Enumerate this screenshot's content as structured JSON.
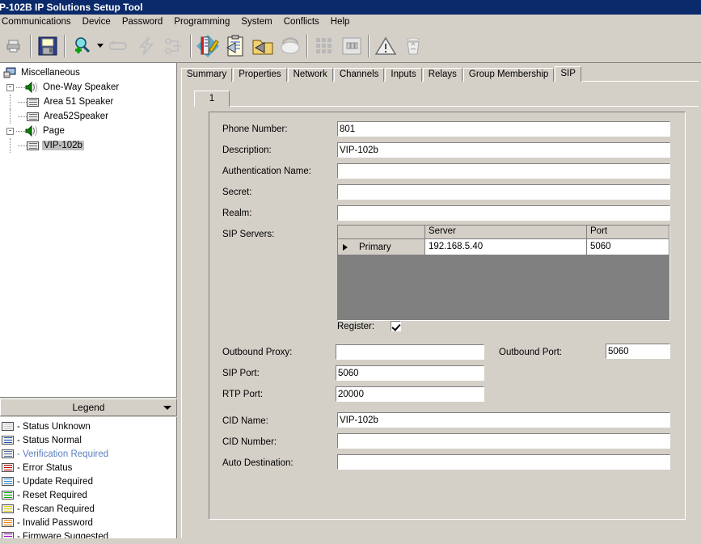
{
  "window": {
    "title": "P-102B IP Solutions Setup Tool",
    "title_color": "#0b2a6b"
  },
  "menubar": {
    "items": [
      {
        "label": "Communications"
      },
      {
        "label": "Device"
      },
      {
        "label": "Password"
      },
      {
        "label": "Programming"
      },
      {
        "label": "System"
      },
      {
        "label": "Conflicts"
      },
      {
        "label": "Help"
      }
    ]
  },
  "toolbar": {
    "buttons": [
      {
        "name": "print-button",
        "icon": "printer-icon"
      },
      {
        "name": "save-button",
        "icon": "floppy-disk-icon"
      },
      {
        "name": "scan-button",
        "icon": "magnifier-plus-icon"
      },
      {
        "name": "scan-dropdown",
        "icon": "chevron-down-icon"
      },
      {
        "name": "refresh-button",
        "icon": "refresh-arrows-icon"
      },
      {
        "name": "reset-button",
        "icon": "lightning-bolt-icon"
      },
      {
        "name": "network-button",
        "icon": "network-nodes-icon"
      },
      {
        "name": "edit-device-button",
        "icon": "pencil-notebook-icon"
      },
      {
        "name": "import-button",
        "icon": "clipboard-import-icon"
      },
      {
        "name": "export-button",
        "icon": "folder-export-icon"
      },
      {
        "name": "phone-button",
        "icon": "telephone-icon"
      },
      {
        "name": "keypad-button",
        "icon": "dial-keypad-icon"
      },
      {
        "name": "relay-button",
        "icon": "switch-panel-icon"
      },
      {
        "name": "conflicts-button",
        "icon": "warning-triangle-icon"
      },
      {
        "name": "recycle-button",
        "icon": "recycle-bin-icon"
      }
    ]
  },
  "tree": {
    "root": {
      "label": "Miscellaneous",
      "icon": "computer-icon"
    },
    "groups": [
      {
        "label": "One-Way Speaker",
        "icon": "speaker-icon",
        "expander": "-",
        "children": [
          {
            "label": "Area 51 Speaker",
            "icon": "device-icon",
            "selected": false
          },
          {
            "label": "Area52Speaker",
            "icon": "device-icon",
            "selected": false
          }
        ]
      },
      {
        "label": "Page",
        "icon": "speaker-icon",
        "expander": "-",
        "children": [
          {
            "label": "VIP-102b",
            "icon": "device-icon",
            "selected": true
          }
        ]
      }
    ]
  },
  "legend": {
    "title": "Legend",
    "items": [
      {
        "label": "- Status Unknown",
        "color": "#c8c8c8",
        "text_color": "#000000"
      },
      {
        "label": "- Status Normal",
        "color": "#1f4fa8",
        "text_color": "#000000"
      },
      {
        "label": "- Verification Required",
        "color": "#4f6f9f",
        "text_color": "#5a7fbf"
      },
      {
        "label": "- Error Status",
        "color": "#c00000",
        "text_color": "#000000"
      },
      {
        "label": "- Update Required",
        "color": "#2d8fd8",
        "text_color": "#000000"
      },
      {
        "label": "- Reset Required",
        "color": "#00a000",
        "text_color": "#000000"
      },
      {
        "label": "- Rescan Required",
        "color": "#e0d000",
        "text_color": "#000000"
      },
      {
        "label": "- Invalid Password",
        "color": "#f08000",
        "text_color": "#000000"
      },
      {
        "label": "- Firmware Suggested",
        "color": "#a000c0",
        "text_color": "#000000"
      }
    ]
  },
  "tabs": {
    "items": [
      {
        "label": "Summary",
        "active": false
      },
      {
        "label": "Properties",
        "active": false
      },
      {
        "label": "Network",
        "active": false
      },
      {
        "label": "Channels",
        "active": false
      },
      {
        "label": "Inputs",
        "active": false
      },
      {
        "label": "Relays",
        "active": false
      },
      {
        "label": "Group Membership",
        "active": false
      },
      {
        "label": "SIP",
        "active": true
      }
    ]
  },
  "subtabs": {
    "items": [
      {
        "label": "1",
        "active": true
      }
    ]
  },
  "form": {
    "phone_number": {
      "label": "Phone Number:",
      "value": "801"
    },
    "description": {
      "label": "Description:",
      "value": "VIP-102b"
    },
    "authentication_name": {
      "label": "Authentication Name:",
      "value": ""
    },
    "secret": {
      "label": "Secret:",
      "value": ""
    },
    "realm": {
      "label": "Realm:",
      "value": ""
    },
    "sip_servers": {
      "label": "SIP Servers:",
      "columns": [
        "",
        "Server",
        "Port"
      ],
      "rows": [
        {
          "role": "Primary",
          "server": "192.168.5.40",
          "port": "5060",
          "selected": true
        }
      ]
    },
    "register": {
      "label": "Register:",
      "checked": true
    },
    "outbound_proxy": {
      "label": "Outbound Proxy:",
      "value": ""
    },
    "outbound_port": {
      "label": "Outbound Port:",
      "value": "5060"
    },
    "sip_port": {
      "label": "SIP Port:",
      "value": "5060"
    },
    "rtp_port": {
      "label": "RTP Port:",
      "value": "20000"
    },
    "cid_name": {
      "label": "CID Name:",
      "value": "VIP-102b"
    },
    "cid_number": {
      "label": "CID Number:",
      "value": ""
    },
    "auto_destination": {
      "label": "Auto Destination:",
      "value": ""
    }
  }
}
